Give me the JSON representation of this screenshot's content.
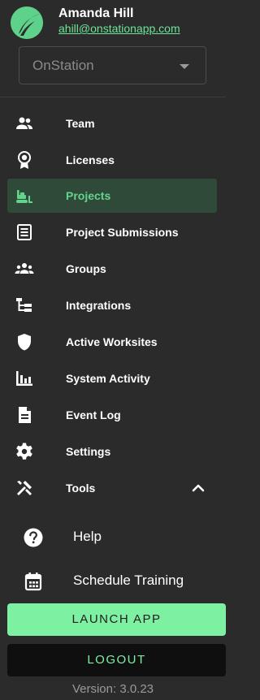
{
  "user": {
    "name": "Amanda Hill",
    "email": "ahill@onstationapp.com",
    "logo_icon": "leaf-logo-icon"
  },
  "org_select": {
    "value": "OnStation",
    "icon": "caret-down-icon"
  },
  "nav": {
    "items": [
      {
        "label": "Team",
        "icon": "team-icon",
        "active": false
      },
      {
        "label": "Licenses",
        "icon": "badge-icon",
        "active": false
      },
      {
        "label": "Projects",
        "icon": "bulldozer-icon",
        "active": true
      },
      {
        "label": "Project Submissions",
        "icon": "form-icon",
        "active": false
      },
      {
        "label": "Groups",
        "icon": "groups-icon",
        "active": false
      },
      {
        "label": "Integrations",
        "icon": "tree-structure-icon",
        "active": false
      },
      {
        "label": "Active Worksites",
        "icon": "shield-icon",
        "active": false
      },
      {
        "label": "System Activity",
        "icon": "bar-chart-icon",
        "active": false
      },
      {
        "label": "Event Log",
        "icon": "document-icon",
        "active": false
      },
      {
        "label": "Settings",
        "icon": "gear-icon",
        "active": false
      },
      {
        "label": "Tools",
        "icon": "tools-icon",
        "active": false,
        "expanded": true
      }
    ]
  },
  "tools_sub": [
    {
      "label": "Help",
      "icon": "help-icon"
    },
    {
      "label": "Schedule Training",
      "icon": "calendar-icon"
    }
  ],
  "buttons": {
    "launch": "LAUNCH APP",
    "logout": "LOGOUT"
  },
  "version": "Version: 3.0.23",
  "colors": {
    "background": "#2b2b2b",
    "accent": "#63d48e",
    "launch_bg": "#7ef0a2",
    "active_bg": "#2f4a38"
  }
}
